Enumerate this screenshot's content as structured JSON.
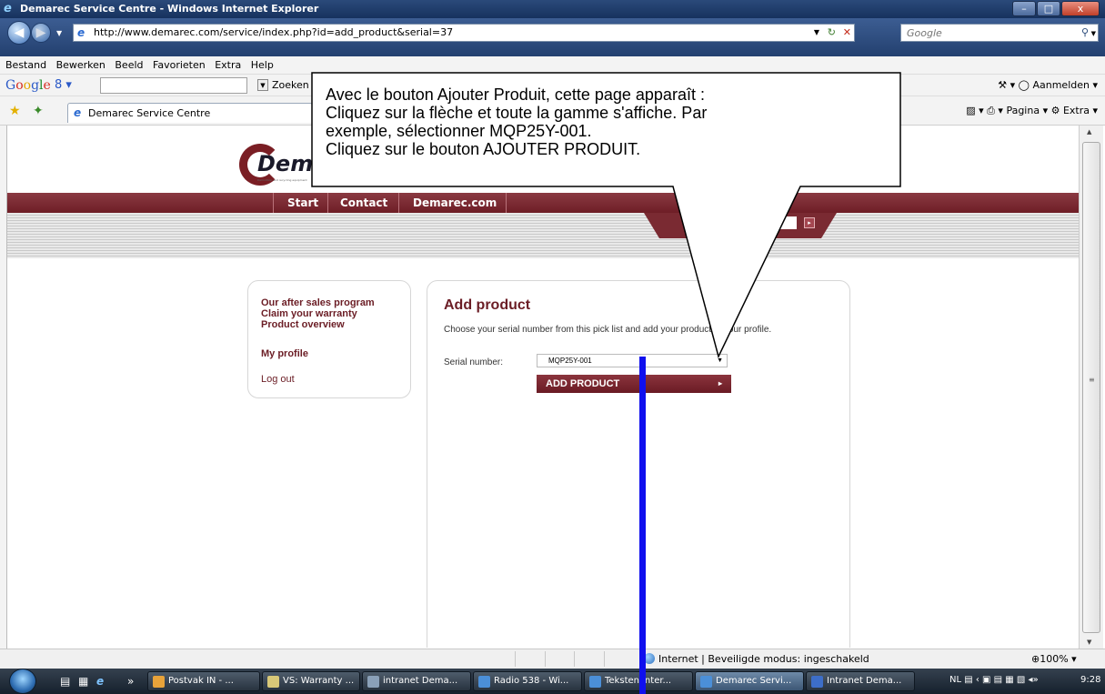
{
  "window": {
    "title": "Demarec Service Centre - Windows Internet Explorer",
    "url": "http://www.demarec.com/service/index.php?id=add_product&serial=37",
    "search_placeholder": "Google",
    "minimize": "–",
    "maximize": "□",
    "close": "x"
  },
  "menubar": [
    "Bestand",
    "Bewerken",
    "Beeld",
    "Favorieten",
    "Extra",
    "Help"
  ],
  "google_toolbar": {
    "select": "8 ▾",
    "zoeken": "Zoeken",
    "right": "⚒ ▾  ◯ Aanmelden ▾"
  },
  "tab": {
    "label": "Demarec Service Centre",
    "right_tools": "▨ ▾  ⎙ ▾  Pagina ▾  ⚙ Extra ▾"
  },
  "site": {
    "logo_text": "Demarec",
    "logo_tagline": "Demolition and recycling equipment",
    "nav": [
      "Start",
      "Contact",
      "Demarec.com"
    ],
    "login_arrow": "▸",
    "sidebar": {
      "after_sales": "Our after sales program",
      "claim_warranty": "Claim your warranty",
      "product_overview": "Product overview",
      "my_profile": "My profile",
      "log_out": "Log out"
    },
    "main": {
      "heading": "Add product",
      "description": "Choose your serial number from this pick list and add your product to your profile.",
      "serial_label": "Serial number:",
      "serial_value": "MQP25Y-001",
      "add_button": "ADD PRODUCT",
      "add_arrow": "▸"
    }
  },
  "callout": {
    "lines": [
      "Avec le bouton Ajouter Produit, cette page apparaît :",
      "Cliquez sur la flèche et toute la gamme s'affiche. Par",
      "exemple, sélectionner MQP25Y-001.",
      "Cliquez sur le bouton AJOUTER PRODUIT."
    ]
  },
  "statusbar": {
    "zone": "Internet | Beveiligde modus: ingeschakeld",
    "zoom": "⊕100%  ▾"
  },
  "taskbar": {
    "buttons": [
      "Postvak IN - ...",
      "VS: Warranty ...",
      "intranet Dema...",
      "Radio 538 - Wi...",
      "Teksten inter...",
      "Demarec Servi...",
      "Intranet Dema..."
    ],
    "tray": "NL ▤ ‹ ▣ ▤  ▦ ▧ ◂»",
    "clock": "9:28"
  }
}
